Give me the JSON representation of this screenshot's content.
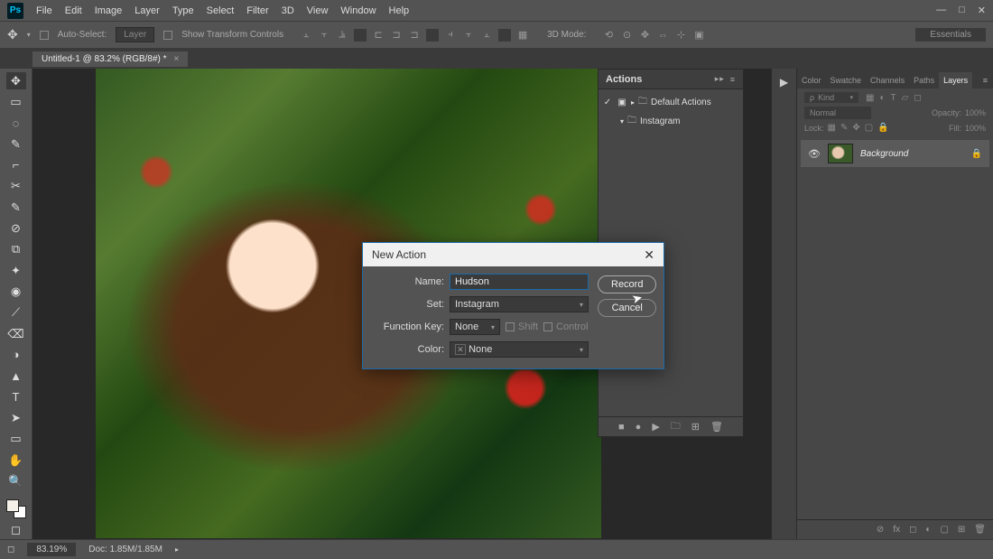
{
  "menubar": [
    "File",
    "Edit",
    "Image",
    "Layer",
    "Type",
    "Select",
    "Filter",
    "3D",
    "View",
    "Window",
    "Help"
  ],
  "optionsbar": {
    "auto_select": "Auto-Select:",
    "layer_dd": "Layer",
    "show_transform": "Show Transform Controls",
    "mode_lbl": "3D Mode:",
    "workspace": "Essentials"
  },
  "doctab": {
    "title": "Untitled-1 @ 83.2% (RGB/8#) *"
  },
  "tools": [
    "✥",
    "▭",
    "◌",
    "✎",
    "⌐",
    "✂",
    "✎",
    "⊘",
    "⧉",
    "✦",
    "◉",
    "⟋",
    "⌫",
    "◑",
    "▲",
    "●",
    "T",
    "➤",
    "▭",
    "✋",
    "🔍"
  ],
  "actions_panel": {
    "title": "Actions",
    "default_set": "Default Actions",
    "user_set": "Instagram"
  },
  "right_tabs": [
    "Color",
    "Swatche",
    "Channels",
    "Paths",
    "Layers"
  ],
  "layers": {
    "kind_label": "Kind",
    "blend": "Normal",
    "opacity_lbl": "Opacity:",
    "opacity_val": "100%",
    "lock_lbl": "Lock:",
    "fill_lbl": "Fill:",
    "fill_val": "100%",
    "layer_name": "Background"
  },
  "dialog": {
    "title": "New Action",
    "name_lbl": "Name:",
    "name_val": "Hudson",
    "set_lbl": "Set:",
    "set_val": "Instagram",
    "fkey_lbl": "Function Key:",
    "fkey_val": "None",
    "shift": "Shift",
    "control": "Control",
    "color_lbl": "Color:",
    "color_val": "None",
    "record": "Record",
    "cancel": "Cancel"
  },
  "statusbar": {
    "zoom": "83.19%",
    "doc": "Doc: 1.85M/1.85M"
  }
}
